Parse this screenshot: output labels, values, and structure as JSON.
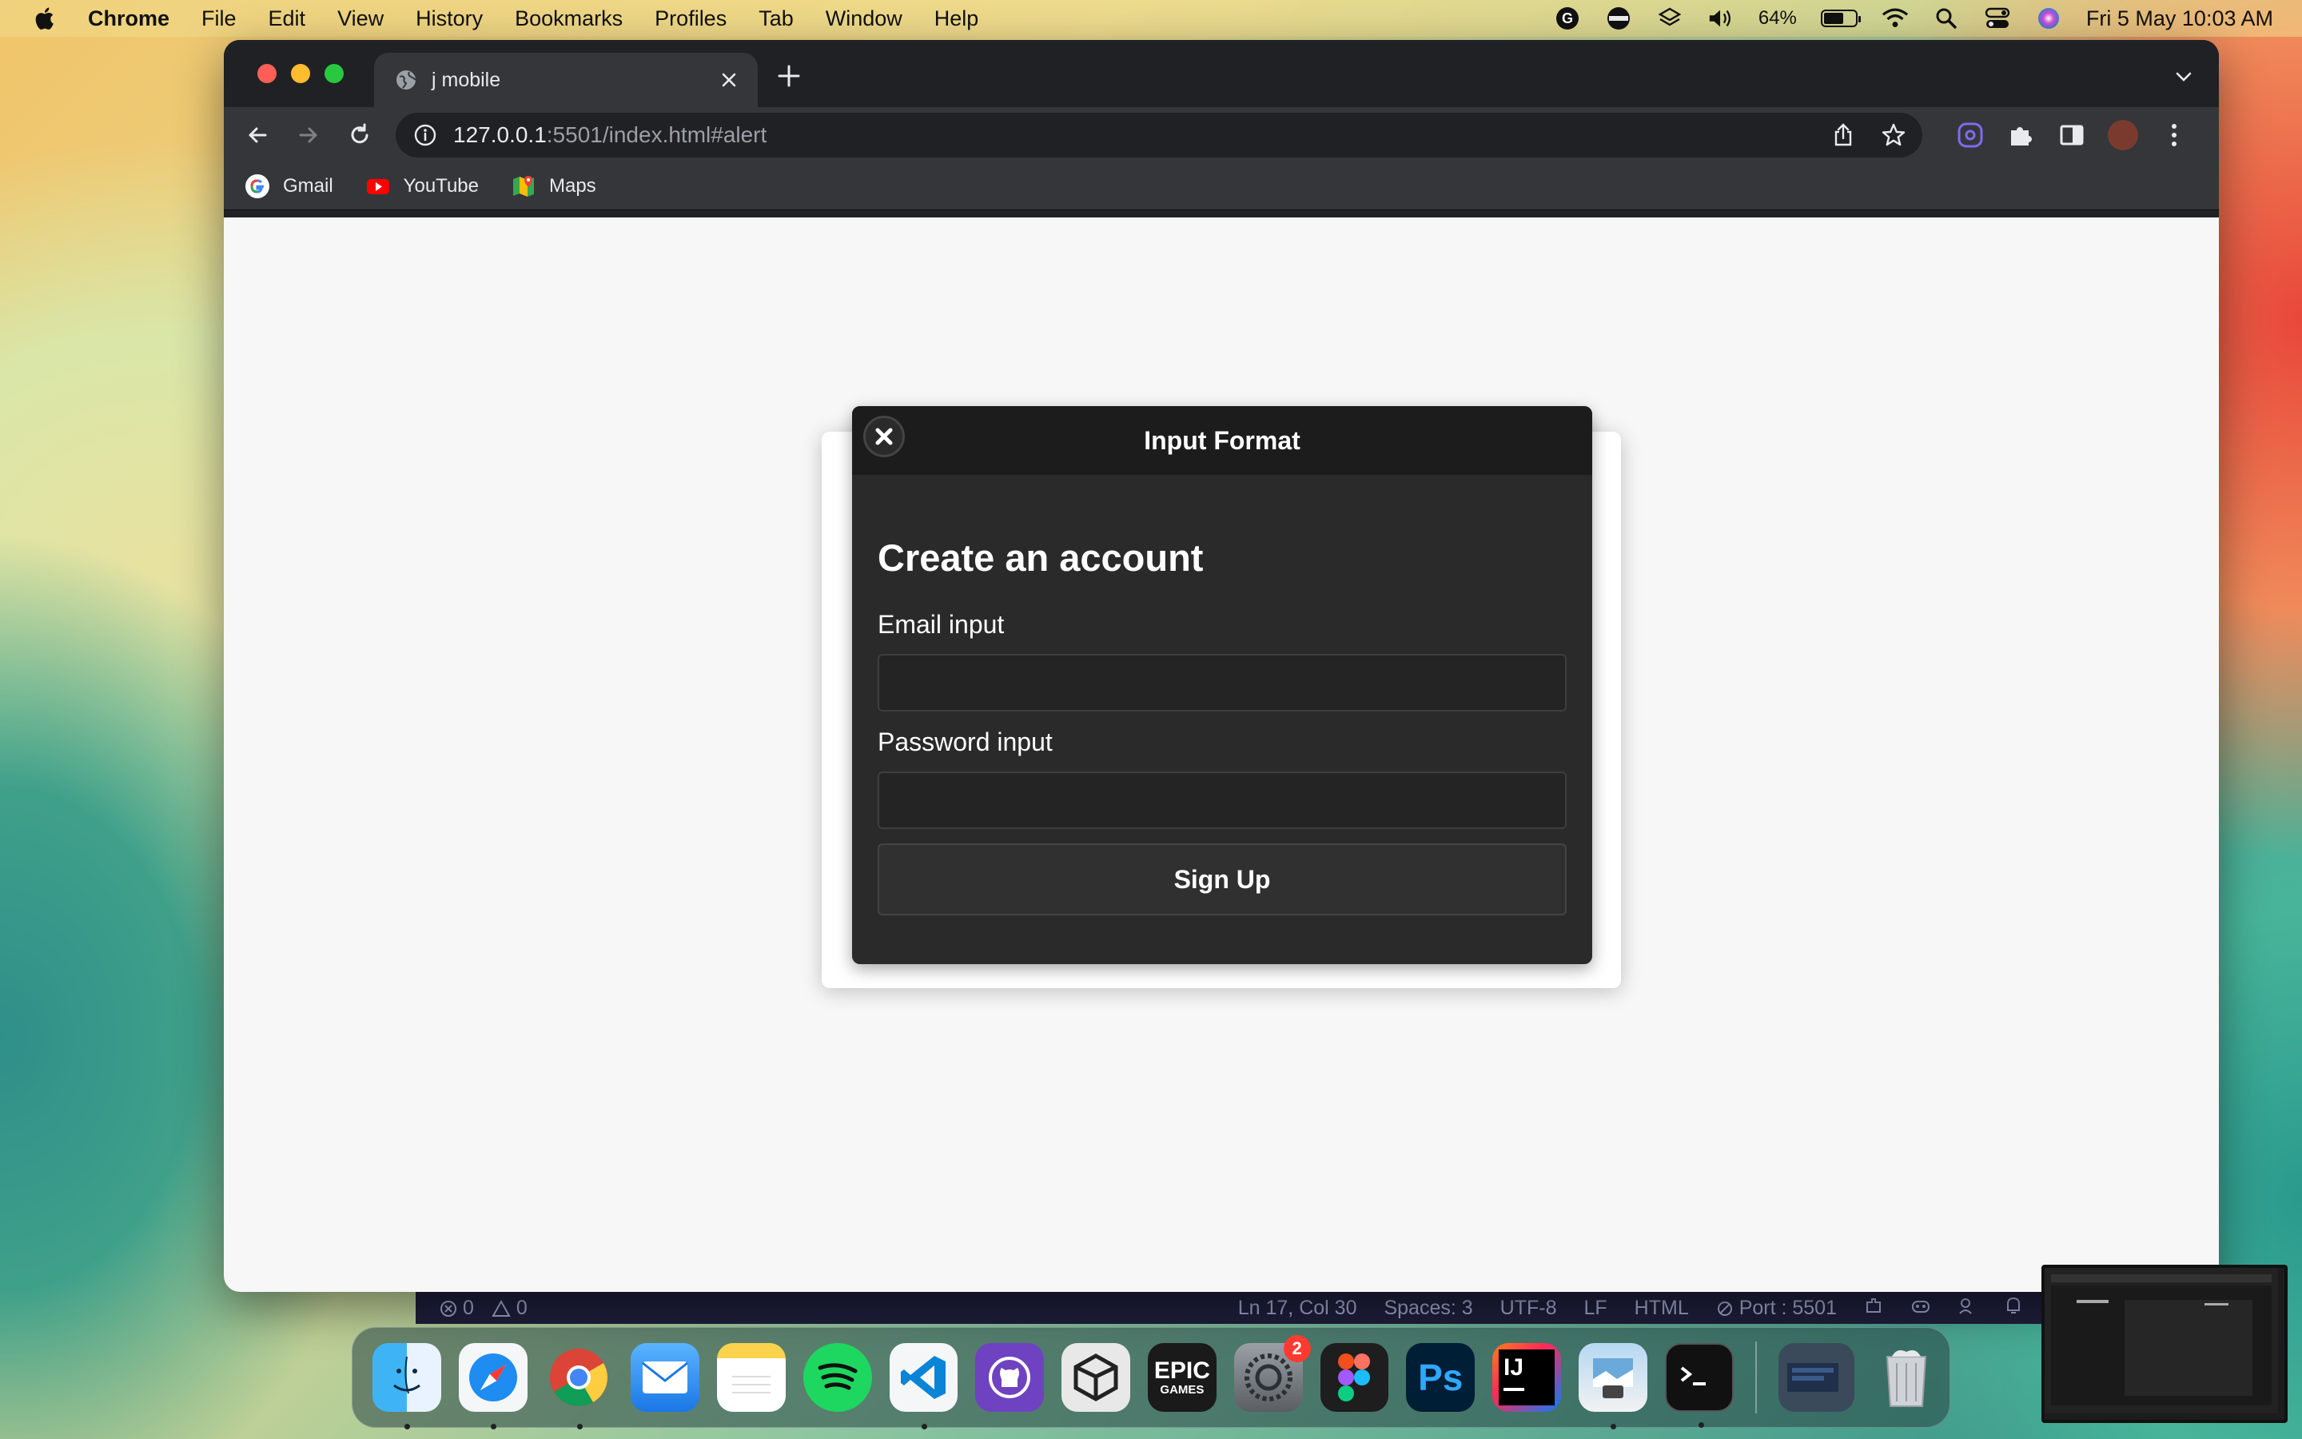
{
  "menubar": {
    "app_name": "Chrome",
    "items": [
      "File",
      "Edit",
      "View",
      "History",
      "Bookmarks",
      "Profiles",
      "Tab",
      "Window",
      "Help"
    ],
    "battery_percent": "64%",
    "battery_level": 0.64,
    "clock": "Fri 5 May  10:03 AM"
  },
  "browser": {
    "tab_title": "j mobile",
    "url_host": "127.0.0.1",
    "url_rest": ":5501/index.html#alert",
    "bookmarks": [
      {
        "label": "Gmail",
        "icon": "google-icon"
      },
      {
        "label": "YouTube",
        "icon": "youtube-icon"
      },
      {
        "label": "Maps",
        "icon": "maps-icon"
      }
    ]
  },
  "popup": {
    "header": "Input Format",
    "title": "Create an account",
    "email_label": "Email input",
    "email_value": "",
    "password_label": "Password input",
    "password_value": "",
    "submit_label": "Sign Up"
  },
  "statusbar": {
    "problems": "0",
    "warnings": "0",
    "position": "Ln 17, Col 30",
    "spaces": "Spaces: 3",
    "encoding": "UTF-8",
    "eol": "LF",
    "language": "HTML",
    "port": "Port : 5501"
  },
  "dock": {
    "apps": [
      "Finder",
      "Safari",
      "Chrome",
      "Mail",
      "Notes",
      "Spotify",
      "VS Code",
      "GitHub Desktop",
      "Unity",
      "Epic Games",
      "System Settings",
      "Figma",
      "Photoshop",
      "IntelliJ IDEA",
      "Preview",
      "Terminal"
    ],
    "settings_badge": "2",
    "epic_label_1": "EPIC",
    "epic_label_2": "GAMES",
    "ps_label": "Ps",
    "ij_label": "IJ"
  },
  "colors": {
    "popup_bg": "#2a2a2a",
    "popup_header_bg": "#1c1c1c",
    "page_bg": "#f7f7f7",
    "chrome_toolbar": "#35363a"
  }
}
